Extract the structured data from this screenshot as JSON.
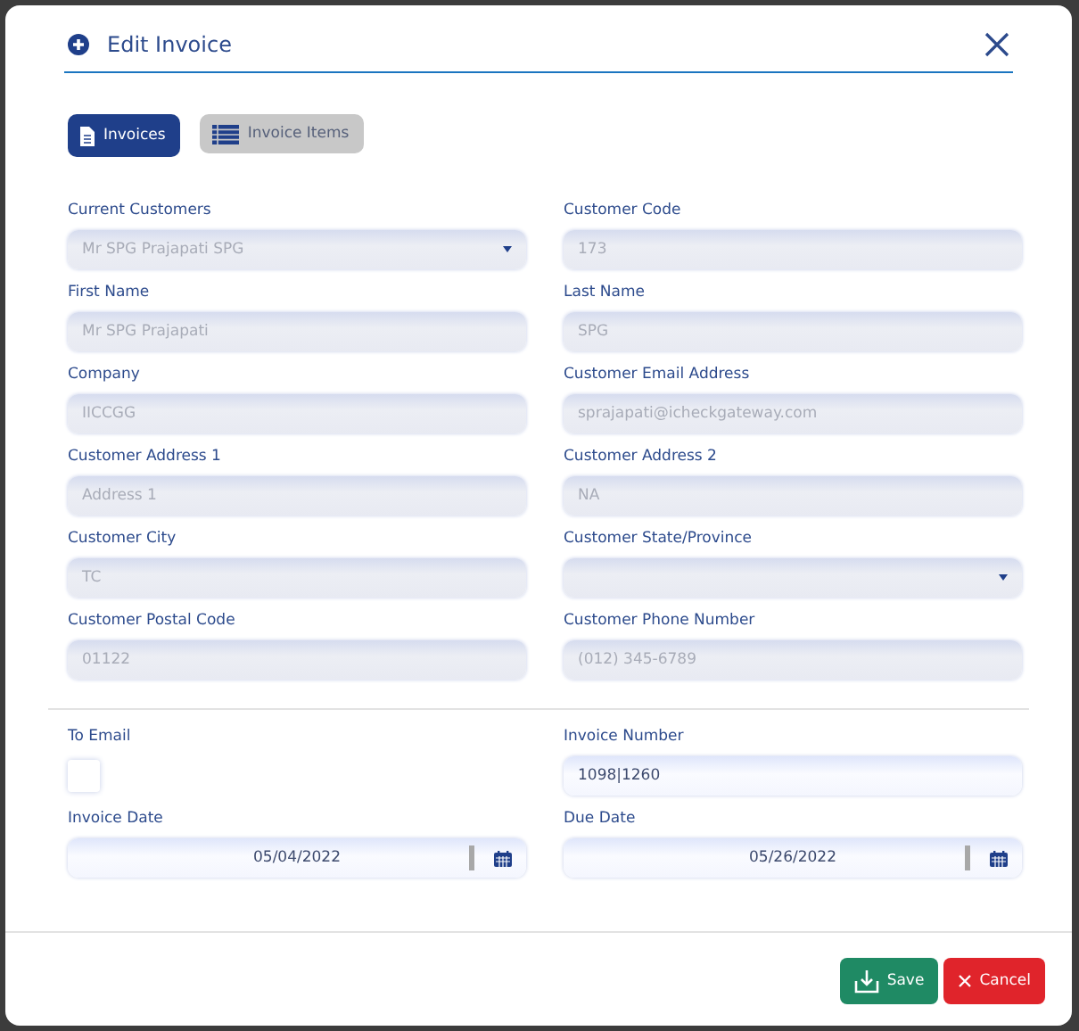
{
  "dialog": {
    "title": "Edit Invoice"
  },
  "tabs": [
    {
      "label": "Invoices",
      "selected": true
    },
    {
      "label": "Invoice Items",
      "selected": false
    }
  ],
  "customer_fields": [
    {
      "label": "Current Customers",
      "value": "Mr SPG Prajapati SPG",
      "kind": "select",
      "disabled": true
    },
    {
      "label": "Customer Code",
      "value": "173",
      "kind": "text",
      "disabled": true
    },
    {
      "label": "First Name",
      "value": "Mr SPG Prajapati",
      "kind": "text",
      "disabled": true
    },
    {
      "label": "Last Name",
      "value": "SPG",
      "kind": "text",
      "disabled": true
    },
    {
      "label": "Company",
      "value": "IICCGG",
      "kind": "text",
      "disabled": true
    },
    {
      "label": "Customer Email Address",
      "value": "sprajapati@icheckgateway.com",
      "kind": "text",
      "disabled": true
    },
    {
      "label": "Customer Address 1",
      "value": "Address 1",
      "kind": "text",
      "disabled": true
    },
    {
      "label": "Customer Address 2",
      "value": "NA",
      "kind": "text",
      "disabled": true
    },
    {
      "label": "Customer City",
      "value": "TC",
      "kind": "text",
      "disabled": true
    },
    {
      "label": "Customer State/Province",
      "kind": "select",
      "disabled": true
    },
    {
      "label": "Customer Postal Code",
      "value": "01122",
      "kind": "text",
      "disabled": true
    },
    {
      "label": "Customer Phone Number",
      "value": "(012) 345-6789",
      "kind": "text",
      "disabled": true
    }
  ],
  "invoice_fields": [
    {
      "label": "To Email",
      "kind": "checkbox",
      "checked": false
    },
    {
      "label": "Invoice Number",
      "value": "1098|1260",
      "kind": "text",
      "disabled": false
    },
    {
      "label": "Invoice Date",
      "value": "05/04/2022",
      "kind": "date",
      "disabled": false
    },
    {
      "label": "Due Date",
      "value": "05/26/2022",
      "kind": "date",
      "disabled": false
    }
  ],
  "buttons": [
    {
      "label": "Save",
      "kind": "save"
    },
    {
      "label": "Cancel",
      "kind": "cancel"
    }
  ]
}
